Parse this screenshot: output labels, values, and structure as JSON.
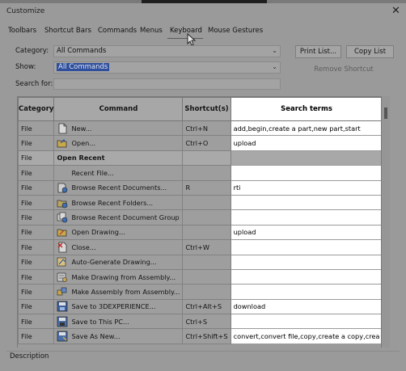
{
  "window": {
    "title": "Customize",
    "close_label": "✕"
  },
  "tabs": [
    "Toolbars",
    "Shortcut Bars",
    "Commands",
    "Menus",
    "Keyboard",
    "Mouse Gestures"
  ],
  "active_tab": "Keyboard",
  "form": {
    "category_label": "Category:",
    "category_value": "All Commands",
    "show_label": "Show:",
    "show_value": "All Commands",
    "search_label": "Search for:",
    "search_value": ""
  },
  "buttons": {
    "print_list": "Print List...",
    "copy_list": "Copy List",
    "remove_shortcut": "Remove Shortcut"
  },
  "table": {
    "columns": [
      "Category",
      "Command",
      "Shortcut(s)",
      "Search terms"
    ],
    "rows": [
      {
        "category": "File",
        "command": "New...",
        "shortcut": "Ctrl+N",
        "terms": "add,begin,create a part,new part,start",
        "icon": "new-doc-icon",
        "header": false
      },
      {
        "category": "File",
        "command": "Open...",
        "shortcut": "Ctrl+O",
        "terms": "upload",
        "icon": "open-folder-icon",
        "header": false
      },
      {
        "category": "File",
        "command": "Open Recent",
        "shortcut": "",
        "terms": "",
        "icon": "",
        "header": true
      },
      {
        "category": "File",
        "command": "Recent File...",
        "shortcut": "",
        "terms": "",
        "icon": "",
        "header": false
      },
      {
        "category": "File",
        "command": "Browse Recent Documents...",
        "shortcut": "R",
        "terms": "rti",
        "icon": "recent-docs-icon",
        "header": false
      },
      {
        "category": "File",
        "command": "Browse Recent Folders...",
        "shortcut": "",
        "terms": "",
        "icon": "recent-folders-icon",
        "header": false
      },
      {
        "category": "File",
        "command": "Browse Recent Document Group",
        "shortcut": "",
        "terms": "",
        "icon": "recent-group-icon",
        "header": false
      },
      {
        "category": "File",
        "command": "Open Drawing...",
        "shortcut": "",
        "terms": "upload",
        "icon": "open-drawing-icon",
        "header": false
      },
      {
        "category": "File",
        "command": "Close...",
        "shortcut": "Ctrl+W",
        "terms": "",
        "icon": "close-doc-icon",
        "header": false
      },
      {
        "category": "File",
        "command": "Auto-Generate Drawing...",
        "shortcut": "",
        "terms": "",
        "icon": "auto-drawing-icon",
        "header": false
      },
      {
        "category": "File",
        "command": "Make Drawing from Assembly...",
        "shortcut": "",
        "terms": "",
        "icon": "make-drawing-icon",
        "header": false
      },
      {
        "category": "File",
        "command": "Make Assembly from Assembly...",
        "shortcut": "",
        "terms": "",
        "icon": "make-assembly-icon",
        "header": false
      },
      {
        "category": "File",
        "command": "Save to 3DEXPERIENCE...",
        "shortcut": "Ctrl+Alt+S",
        "terms": "download",
        "icon": "save-3dx-icon",
        "header": false
      },
      {
        "category": "File",
        "command": "Save to This PC...",
        "shortcut": "Ctrl+S",
        "terms": "",
        "icon": "save-pc-icon",
        "header": false
      },
      {
        "category": "File",
        "command": "Save As New...",
        "shortcut": "Ctrl+Shift+S",
        "terms": "convert,convert file,copy,create a copy,crea",
        "icon": "save-as-new-icon",
        "header": false
      }
    ]
  },
  "footer": {
    "description_label": "Description"
  },
  "colors": {
    "selection": "#2f4f9c",
    "search_terms_bg": "#ffffff",
    "dim_bg": "#9a9a9a"
  }
}
